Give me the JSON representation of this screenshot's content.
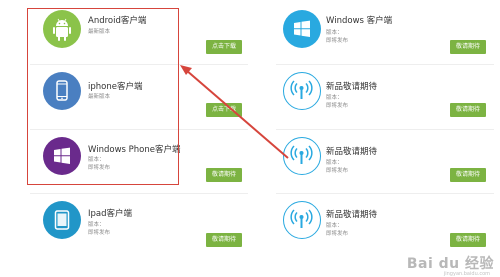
{
  "left_items": [
    {
      "icon": "android-icon",
      "title": "Android客户端",
      "sub1": "最新版本",
      "sub2": "",
      "button": "点击下载",
      "color": "#8bc34a"
    },
    {
      "icon": "iphone-icon",
      "title": "iphone客户端",
      "sub1": "最新版本",
      "sub2": "",
      "button": "点击下载",
      "color": "#4a7fc1"
    },
    {
      "icon": "windows-phone-icon",
      "title": "Windows Phone客户端",
      "sub1": "版本：",
      "sub2": "即将发布",
      "button": "敬请期待",
      "color": "#6a2a8c"
    },
    {
      "icon": "ipad-icon",
      "title": "Ipad客户端",
      "sub1": "版本：",
      "sub2": "即将发布",
      "button": "敬请期待",
      "color": "#2196c8"
    }
  ],
  "right_items": [
    {
      "icon": "windows-icon",
      "title": "Windows 客户端",
      "sub1": "版本：",
      "sub2": "即将发布",
      "button": "敬请期待",
      "color": "#29a9e0"
    },
    {
      "icon": "broadcast-icon",
      "title": "新品敬请期待",
      "sub1": "版本：",
      "sub2": "即将发布",
      "button": "敬请期待",
      "color": "#29a9e0"
    },
    {
      "icon": "broadcast-icon",
      "title": "新品敬请期待",
      "sub1": "版本：",
      "sub2": "即将发布",
      "button": "敬请期待",
      "color": "#29a9e0"
    },
    {
      "icon": "broadcast-icon",
      "title": "新品敬请期待",
      "sub1": "版本：",
      "sub2": "即将发布",
      "button": "敬请期待",
      "color": "#29a9e0"
    }
  ],
  "watermark": "Bai du 经验",
  "watermark_sub": "jingyan.baidu.com",
  "colors": {
    "button": "#7cb342",
    "highlight": "#d6453c"
  }
}
